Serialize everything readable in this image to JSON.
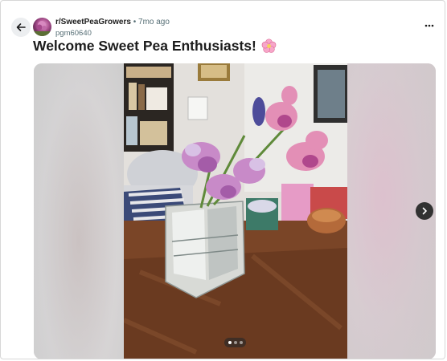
{
  "post": {
    "subreddit": "r/SweetPeaGrowers",
    "separator": "•",
    "time_ago": "7mo ago",
    "username": "pgm60640",
    "title": "Welcome Sweet Pea Enthusiasts!",
    "title_emoji": "flower-emoji"
  },
  "icons": {
    "back": "back-arrow-icon",
    "more": "more-options-icon",
    "next": "chevron-right-icon"
  },
  "gallery": {
    "image_count": 3,
    "current_index": 1
  }
}
